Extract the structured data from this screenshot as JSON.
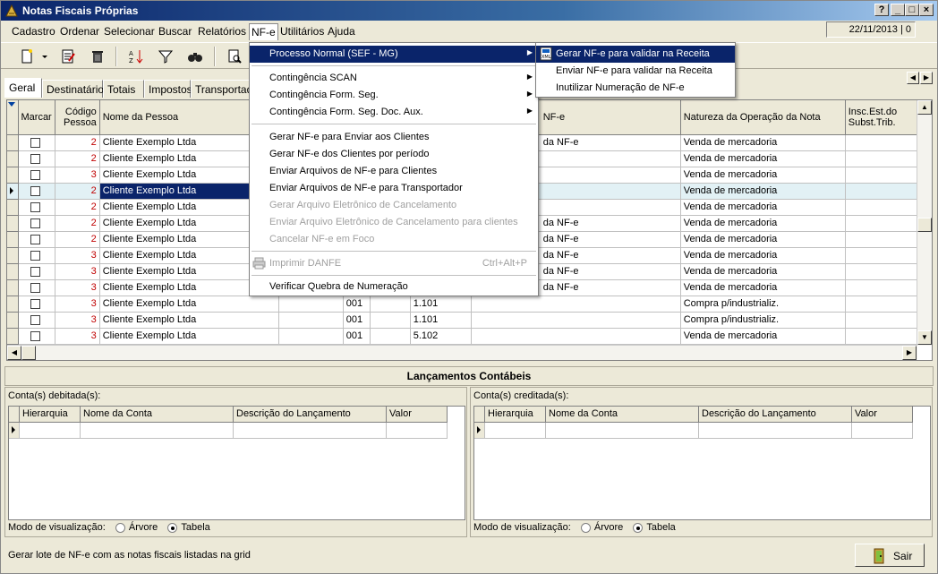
{
  "window": {
    "title": "Notas Fiscais Próprias",
    "date": "22/11/2013 | 0"
  },
  "menubar": [
    "Cadastro",
    "Ordenar",
    "Selecionar",
    "Buscar",
    "Relatórios",
    "NF-e",
    "Utilitários",
    "Ajuda"
  ],
  "tabs": [
    "Geral",
    "Destinatário",
    "Totais",
    "Impostos",
    "Transportado"
  ],
  "grid": {
    "headers": {
      "marcar": "Marcar",
      "codigo": "Código Pessoa",
      "nome": "Nome da Pessoa",
      "nfe": "NF-e",
      "natureza": "Natureza da Operação da Nota",
      "insc": "Insc.Est.do Subst.Trib."
    },
    "rows": [
      {
        "codigo": "2",
        "nome": "Cliente Exemplo Ltda",
        "serie": "",
        "cfop": "",
        "nfe": "da NF-e",
        "natureza": "Venda de mercadoria"
      },
      {
        "codigo": "2",
        "nome": "Cliente Exemplo Ltda",
        "serie": "",
        "cfop": "",
        "nfe": "",
        "natureza": "Venda de mercadoria"
      },
      {
        "codigo": "3",
        "nome": "Cliente Exemplo Ltda",
        "serie": "",
        "cfop": "",
        "nfe": "",
        "natureza": "Venda de mercadoria"
      },
      {
        "codigo": "2",
        "nome": "Cliente Exemplo Ltda",
        "serie": "",
        "cfop": "",
        "nfe": "",
        "natureza": "Venda de mercadoria"
      },
      {
        "codigo": "2",
        "nome": "Cliente Exemplo Ltda",
        "serie": "",
        "cfop": "",
        "nfe": "",
        "natureza": "Venda de mercadoria"
      },
      {
        "codigo": "2",
        "nome": "Cliente Exemplo Ltda",
        "serie": "",
        "cfop": "",
        "nfe": "da NF-e",
        "natureza": "Venda de mercadoria"
      },
      {
        "codigo": "2",
        "nome": "Cliente Exemplo Ltda",
        "serie": "",
        "cfop": "",
        "nfe": "da NF-e",
        "natureza": "Venda de mercadoria"
      },
      {
        "codigo": "3",
        "nome": "Cliente Exemplo Ltda",
        "serie": "",
        "cfop": "",
        "nfe": "da NF-e",
        "natureza": "Venda de mercadoria"
      },
      {
        "codigo": "3",
        "nome": "Cliente Exemplo Ltda",
        "serie": "",
        "cfop": "",
        "nfe": "da NF-e",
        "natureza": "Venda de mercadoria"
      },
      {
        "codigo": "3",
        "nome": "Cliente Exemplo Ltda",
        "serie": "",
        "cfop": "",
        "nfe": "da NF-e",
        "natureza": "Venda de mercadoria"
      },
      {
        "codigo": "3",
        "nome": "Cliente Exemplo Ltda",
        "serie": "001",
        "cfop": "1.101",
        "nfe": "",
        "natureza": "Compra p/industrializ."
      },
      {
        "codigo": "3",
        "nome": "Cliente Exemplo Ltda",
        "serie": "001",
        "cfop": "1.101",
        "nfe": "",
        "natureza": "Compra p/industrializ."
      },
      {
        "codigo": "3",
        "nome": "Cliente Exemplo Ltda",
        "serie": "001",
        "cfop": "5.102",
        "nfe": "",
        "natureza": "Venda de mercadoria"
      }
    ],
    "selected_row": 3
  },
  "nfe_menu": {
    "items": [
      {
        "label": "Processo Normal (SEF - MG)",
        "submenu": true,
        "highlight": true
      },
      {
        "label": "Contingência SCAN",
        "submenu": true
      },
      {
        "label": "Contingência Form. Seg.",
        "submenu": true
      },
      {
        "label": "Contingência Form. Seg. Doc. Aux.",
        "submenu": true
      },
      {
        "label": "Gerar NF-e para Enviar aos Clientes"
      },
      {
        "label": "Gerar NF-e dos Clientes por período"
      },
      {
        "label": "Enviar Arquivos de NF-e para Clientes"
      },
      {
        "label": "Enviar Arquivos de NF-e para Transportador"
      },
      {
        "label": "Gerar Arquivo Eletrônico de Cancelamento",
        "disabled": true
      },
      {
        "label": "Enviar Arquivo Eletrônico de Cancelamento para clientes",
        "disabled": true
      },
      {
        "label": "Cancelar NF-e em Foco",
        "disabled": true
      },
      {
        "label": "Imprimir DANFE",
        "disabled": true,
        "shortcut": "Ctrl+Alt+P"
      },
      {
        "label": "Verificar Quebra de Numeração"
      }
    ]
  },
  "submenu": {
    "items": [
      {
        "label": "Gerar NF-e para validar na Receita",
        "highlight": true
      },
      {
        "label": "Enviar NF-e para validar na Receita"
      },
      {
        "label": "Inutilizar Numeração de NF-e"
      }
    ]
  },
  "lancamentos": {
    "title": "Lançamentos Contábeis",
    "debitada": "Conta(s) debitada(s):",
    "creditada": "Conta(s) creditada(s):",
    "columns": [
      "Hierarquia",
      "Nome da Conta",
      "Descrição do Lançamento",
      "Valor"
    ],
    "view_label": "Modo de visualização:",
    "view_options": [
      "Árvore",
      "Tabela"
    ],
    "view_selected": "Tabela"
  },
  "status": {
    "message": "Gerar lote de NF-e com as notas fiscais listadas na grid",
    "exit_label": "Sair"
  },
  "colors": {
    "title_start": "#0a246a",
    "selection": "#0a246a",
    "selected_row": "#e2f1f5",
    "code_text": "#c00000"
  }
}
